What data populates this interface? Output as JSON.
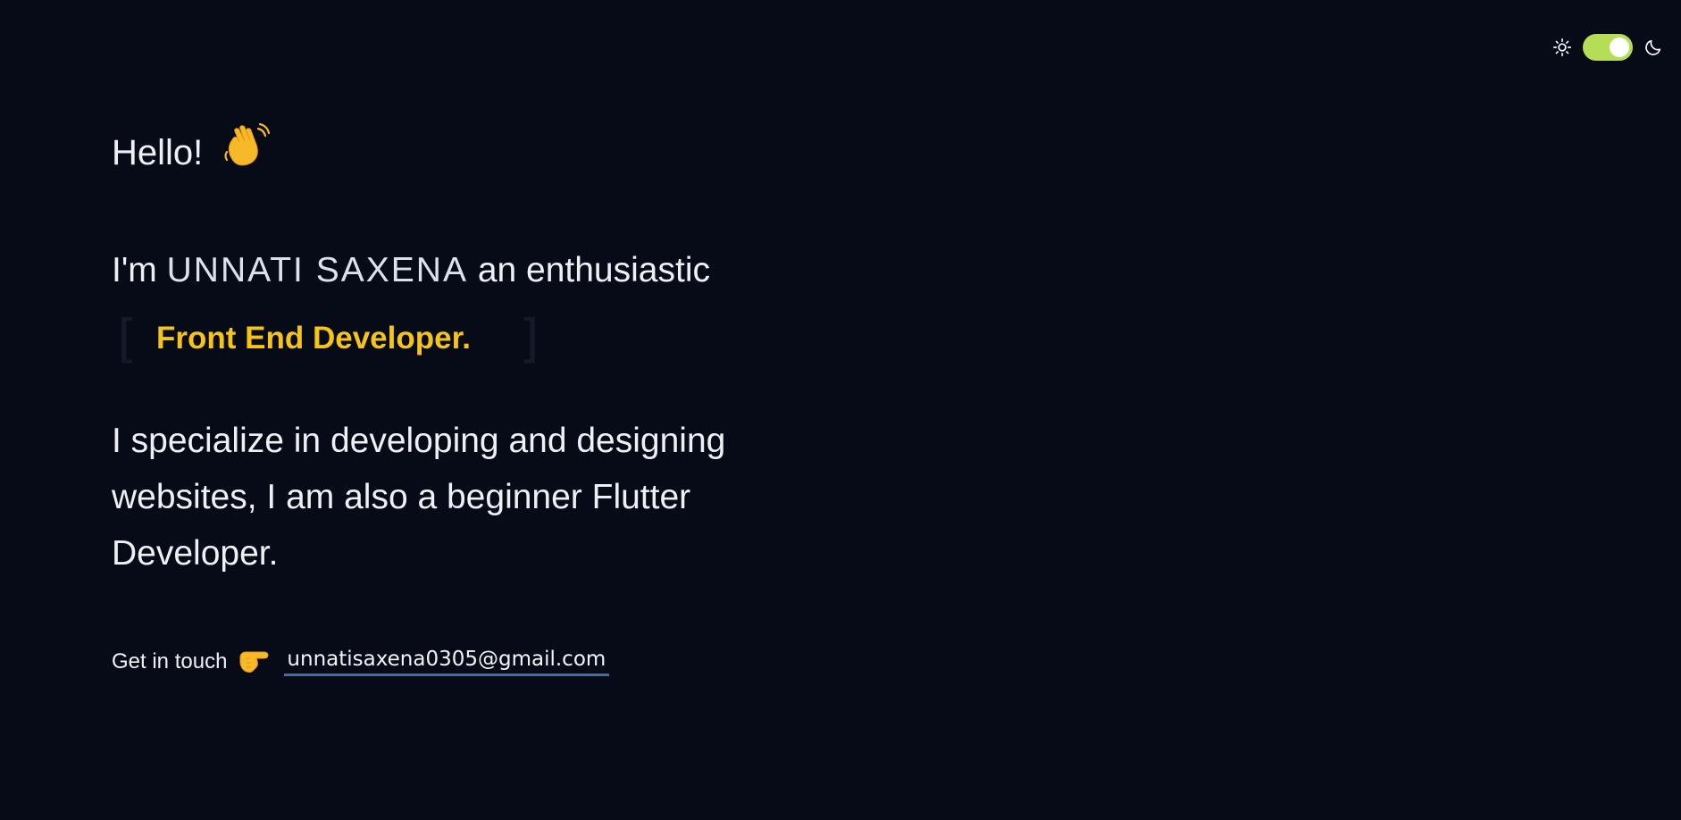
{
  "theme_toggle": {
    "light_icon": "sun-icon",
    "dark_icon": "moon-icon",
    "state": "on",
    "track_color": "#b5dd58"
  },
  "hero": {
    "greeting": "Hello!",
    "greeting_emoji_icon": "waving-hand-icon",
    "intro_prefix": "I'm",
    "name": "UNNATI SAXENA",
    "intro_suffix": "an enthusiastic",
    "bracket_open": "[",
    "role": "Front End Developer.",
    "bracket_close": "]",
    "role_color": "#f6c416",
    "description": "I specialize in developing and designing websites, I am also a beginner Flutter Developer."
  },
  "contact": {
    "label": "Get in touch",
    "pointer_icon": "pointing-right-hand-icon",
    "email": "unnatisaxena0305@gmail.com",
    "underline_color": "#4a6996"
  }
}
